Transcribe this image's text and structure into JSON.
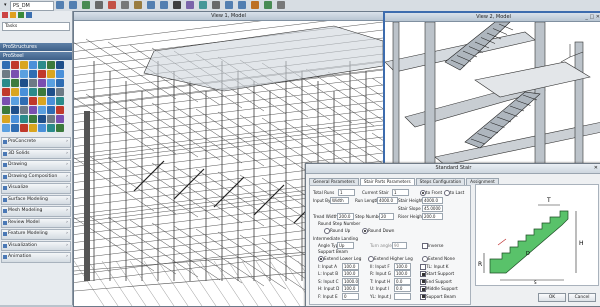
{
  "topbar": {
    "file": "PS_DM",
    "icons": [
      "back-icon",
      "forward-icon",
      "save-icon",
      "print-icon",
      "cut-icon",
      "copy-icon",
      "paste-icon",
      "undo-icon",
      "redo-icon",
      "select-icon",
      "fence-icon",
      "measure-icon",
      "pan-icon",
      "zoom-icon",
      "fit-icon",
      "rotate-icon",
      "render-icon",
      "settings-icon"
    ]
  },
  "left": {
    "search_label": "Tasks",
    "section1": "ProStructures",
    "section2": "ProSteel",
    "tasks": [
      "ProConcrete",
      "3D Solids",
      "Drawing",
      "Drawing Composition",
      "Visualize",
      "Surface Modeling",
      "Mesh Modeling",
      "Review Model",
      "Feature Modeling",
      "Visualization",
      "Animation"
    ]
  },
  "view1": {
    "title": "View 1, Model"
  },
  "view2": {
    "title": "View 2, Model"
  },
  "dialog": {
    "title": "Standard Stair",
    "tabs": [
      "General Parameters",
      "Stair Parts Parameters",
      "Steps Configuration",
      "Assignment"
    ],
    "total_runs_label": "Total Runs",
    "total_runs_value": "1",
    "current_stair_label": "Current Stair",
    "current_stair_value": "1",
    "to_front": "to Front",
    "to_last": "to Last",
    "input_by_label": "Input By",
    "input_by_value": "Width",
    "run_length_label": "Run Length",
    "run_length_value": "4000.0",
    "stair_height_label": "Stair Height",
    "stair_height_value": "4000.0",
    "stair_slope_label": "Stair Slope",
    "stair_slope_value": "45.0000",
    "tread_width_label": "Tread Width",
    "tread_width_value": "200.0",
    "step_number_label": "Step Number",
    "step_number_value": "20",
    "riser_height_label": "Riser Height",
    "riser_height_value": "200.0",
    "round_step_label": "Round Step Number",
    "round_up": "Round Up",
    "round_down": "Round Down",
    "landing_label": "Intermediate Landing",
    "angle_type_label": "Angle Type",
    "angle_type_value": "Up",
    "turn_angle_label": "Turn angle",
    "turn_angle_value": "90",
    "inverse_label": "Inverse",
    "support_beam_label": "Support Beam",
    "extend_lower_leg": "Extend Lower Leg",
    "extend_higher_leg": "Extend Higher Leg",
    "extend_none": "Extend None",
    "inputs": [
      {
        "label": "I: Input A",
        "value": "100.0"
      },
      {
        "label": "L: Input B",
        "value": "100.0"
      },
      {
        "label": "S: Input C",
        "value": "1000.0"
      },
      {
        "label": "H: Input D",
        "value": "100.0"
      },
      {
        "label": "F: Input E",
        "value": "0"
      }
    ],
    "inputs2": [
      {
        "label": "II: Input F",
        "value": "100.0"
      },
      {
        "label": "R: Input G",
        "value": "100.0"
      },
      {
        "label": "T: Input H",
        "value": "0.0"
      },
      {
        "label": "U: Input I",
        "value": "0.0"
      },
      {
        "label": "YL: Input J",
        "value": ""
      }
    ],
    "checks": [
      {
        "label": "TL: Input K",
        "on": false
      },
      {
        "label": "Start Support",
        "on": true
      },
      {
        "label": "End Support",
        "on": true
      },
      {
        "label": "Middle Support",
        "on": true
      },
      {
        "label": "Support Beam",
        "on": true
      }
    ],
    "diagram": {
      "t": "T",
      "h": "H",
      "r": "R",
      "d": "D",
      "dim_s": "S"
    },
    "buttons": [
      "OK",
      "Cancel"
    ]
  }
}
